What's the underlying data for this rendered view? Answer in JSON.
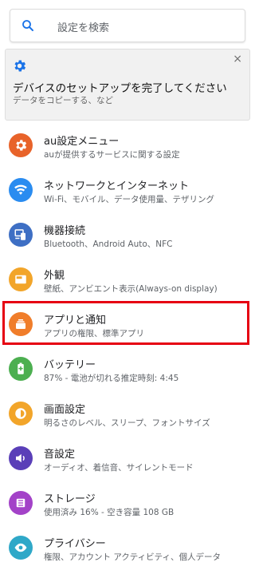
{
  "search": {
    "placeholder": "設定を検索"
  },
  "suggestion": {
    "title": "デバイスのセットアップを完了してください",
    "subtitle": "データをコピーする、など",
    "close": "×"
  },
  "items": [
    {
      "title": "au設定メニュー",
      "subtitle": "auが提供するサービスに関する設定",
      "icon": "au-gear-icon",
      "color": "#e8632a"
    },
    {
      "title": "ネットワークとインターネット",
      "subtitle": "Wi-Fi、モバイル、データ使用量、テザリング",
      "icon": "wifi-icon",
      "color": "#2a8cf0"
    },
    {
      "title": "機器接続",
      "subtitle": "Bluetooth、Android Auto、NFC",
      "icon": "devices-icon",
      "color": "#3e6fc4"
    },
    {
      "title": "外観",
      "subtitle": "壁紙、アンビエント表示(Always-on display)",
      "icon": "display-icon",
      "color": "#f2a52a"
    },
    {
      "title": "アプリと通知",
      "subtitle": "アプリの権限、標準アプリ",
      "icon": "apps-icon",
      "color": "#f07d2a"
    },
    {
      "title": "バッテリー",
      "subtitle": "87% - 電池が切れる推定時刻: 4:45",
      "icon": "battery-icon",
      "color": "#4caf50"
    },
    {
      "title": "画面設定",
      "subtitle": "明るさのレベル、スリープ、フォントサイズ",
      "icon": "brightness-icon",
      "color": "#f2a52a"
    },
    {
      "title": "音設定",
      "subtitle": "オーディオ、着信音、サイレントモード",
      "icon": "volume-icon",
      "color": "#5a3fb8"
    },
    {
      "title": "ストレージ",
      "subtitle": "使用済み 16% - 空き容量 108 GB",
      "icon": "storage-icon",
      "color": "#a342c8"
    },
    {
      "title": "プライバシー",
      "subtitle": "権限、アカウント アクティビティ、個人データ",
      "icon": "privacy-icon",
      "color": "#2fa8c8"
    }
  ]
}
